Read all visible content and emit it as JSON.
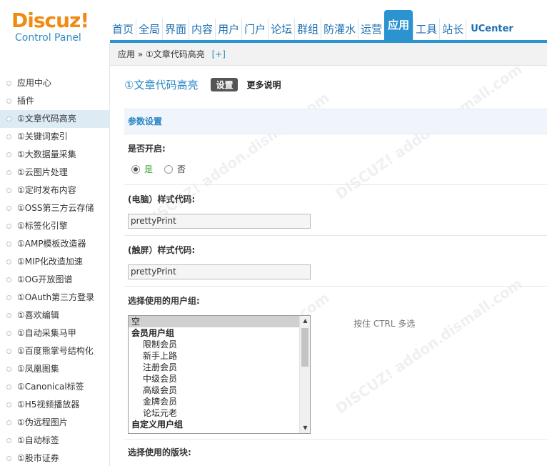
{
  "logo": {
    "brand": "Discuz!",
    "subtitle": "Control Panel"
  },
  "nav": {
    "items": [
      {
        "label": "首页"
      },
      {
        "label": "全局"
      },
      {
        "label": "界面"
      },
      {
        "label": "内容"
      },
      {
        "label": "用户"
      },
      {
        "label": "门户"
      },
      {
        "label": "论坛"
      },
      {
        "label": "群组"
      },
      {
        "label": "防灌水"
      },
      {
        "label": "运营"
      },
      {
        "label": "应用",
        "active": true
      },
      {
        "label": "工具"
      },
      {
        "label": "站长"
      },
      {
        "label": "UCenter"
      }
    ]
  },
  "sidebar": {
    "items": [
      {
        "label": "应用中心"
      },
      {
        "label": "插件"
      },
      {
        "label": "①文章代码高亮",
        "active": true
      },
      {
        "label": "①关键词索引"
      },
      {
        "label": "①大数据量采集"
      },
      {
        "label": "①云图片处理"
      },
      {
        "label": "①定时发布内容"
      },
      {
        "label": "①OSS第三方云存储"
      },
      {
        "label": "①标签化引擎"
      },
      {
        "label": "①AMP模板改造器"
      },
      {
        "label": "①MIP化改造加速"
      },
      {
        "label": "①OG开放图谱"
      },
      {
        "label": "①OAuth第三方登录"
      },
      {
        "label": "①喜欢编辑"
      },
      {
        "label": "①自动采集马甲"
      },
      {
        "label": "①百度熊掌号结构化"
      },
      {
        "label": "①凤凰图集"
      },
      {
        "label": "①Canonical标签"
      },
      {
        "label": "①H5视频播放器"
      },
      {
        "label": "①伪远程图片"
      },
      {
        "label": "①自动标签"
      },
      {
        "label": "①股市证券"
      }
    ]
  },
  "breadcrumb": {
    "path": "应用 » ①文章代码高亮",
    "add": "[+]"
  },
  "main": {
    "title": "①文章代码高亮",
    "tab_settings": "设置",
    "tab_more": "更多说明",
    "section_title": "参数设置",
    "enable_label": "是否开启:",
    "radio_yes": "是",
    "radio_no": "否",
    "radio_selected": "是",
    "pc_style_label": "(电脑）样式代码:",
    "pc_style_value": "prettyPrint",
    "touch_style_label": "(触屏）样式代码:",
    "touch_style_value": "prettyPrint",
    "usergroup_label": "选择使用的用户组:",
    "usergroup_options": [
      {
        "label": "空",
        "type": "option",
        "selected": true
      },
      {
        "label": "会员用户组",
        "type": "group"
      },
      {
        "label": "限制会员",
        "type": "child"
      },
      {
        "label": "新手上路",
        "type": "child"
      },
      {
        "label": "注册会员",
        "type": "child"
      },
      {
        "label": "中级会员",
        "type": "child"
      },
      {
        "label": "高级会员",
        "type": "child"
      },
      {
        "label": "金牌会员",
        "type": "child"
      },
      {
        "label": "论坛元老",
        "type": "child"
      },
      {
        "label": "自定义用户组",
        "type": "group"
      }
    ],
    "usergroup_hint": "按住 CTRL 多选",
    "block_label": "选择使用的版块:"
  },
  "colors": {
    "accent": "#2a93d0",
    "logo": "#f08a13",
    "title": "#2a86c6"
  }
}
